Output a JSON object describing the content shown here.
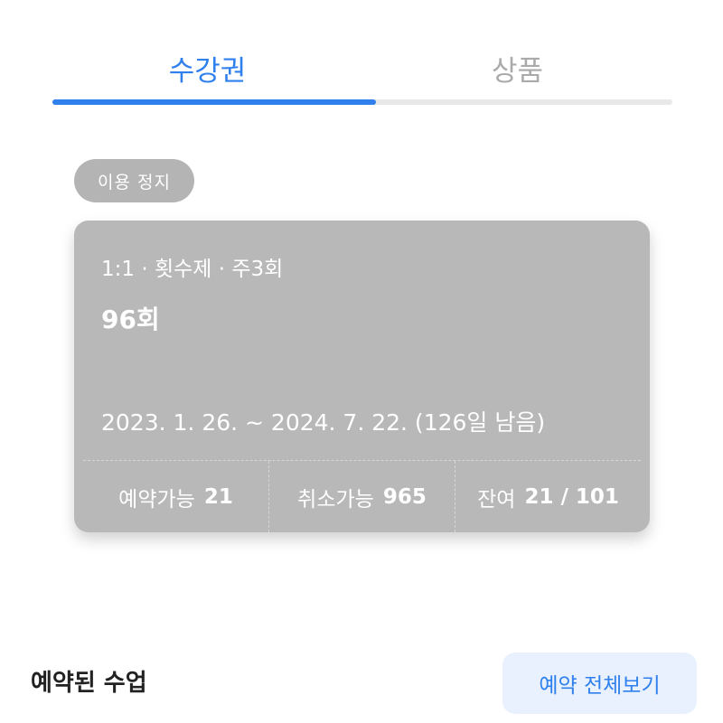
{
  "tabs": {
    "items": [
      {
        "label": "수강권",
        "active": true
      },
      {
        "label": "상품",
        "active": false
      }
    ],
    "accent_color": "#2f80ed"
  },
  "pass": {
    "status": "이용 정지",
    "type": "1:1 · 횟수제 · 주3회",
    "count": "96회",
    "period": "2023. 1. 26. ~ 2024. 7. 22. (126일 남음)",
    "stats": [
      {
        "label": "예약가능",
        "value": "21"
      },
      {
        "label": "취소가능",
        "value": "965"
      },
      {
        "label": "잔여",
        "value": "21 / 101"
      }
    ],
    "card_color": "#b8b8b8"
  },
  "reserved": {
    "title": "예약된 수업",
    "view_all_label": "예약 전체보기"
  }
}
